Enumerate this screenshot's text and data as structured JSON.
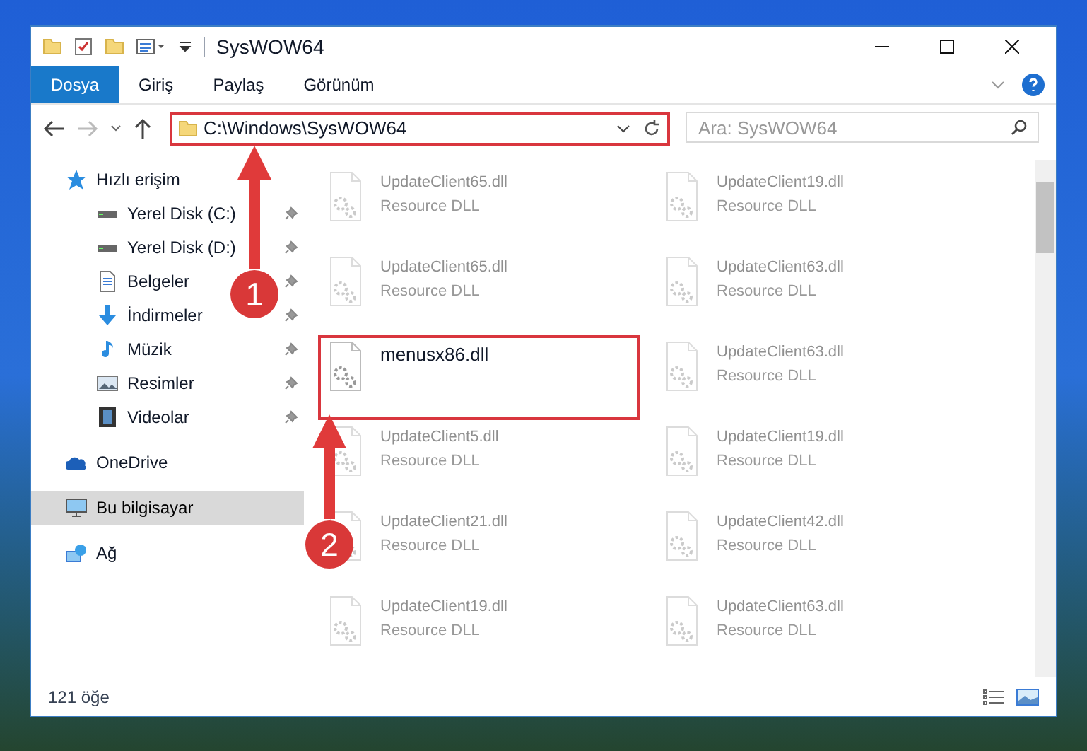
{
  "window": {
    "title": "SysWOW64"
  },
  "ribbon_tabs": [
    {
      "label": "Dosya",
      "selected": true
    },
    {
      "label": "Giriş",
      "selected": false
    },
    {
      "label": "Paylaş",
      "selected": false
    },
    {
      "label": "Görünüm",
      "selected": false
    }
  ],
  "address_bar": {
    "path": "C:\\Windows\\SysWOW64",
    "highlighted": true
  },
  "search": {
    "placeholder": "Ara: SysWOW64"
  },
  "sidebar": {
    "items": [
      {
        "label": "Hızlı erişim",
        "selected": false,
        "children": [
          {
            "label": "Yerel Disk (C:)",
            "pinned": true,
            "selected": false
          },
          {
            "label": "Yerel Disk (D:)",
            "pinned": true,
            "selected": false
          },
          {
            "label": "Belgeler",
            "pinned": true,
            "selected": false
          },
          {
            "label": "İndirmeler",
            "pinned": true,
            "selected": false
          },
          {
            "label": "Müzik",
            "pinned": true,
            "selected": false
          },
          {
            "label": "Resimler",
            "pinned": true,
            "selected": false
          },
          {
            "label": "Videolar",
            "pinned": true,
            "selected": false
          }
        ]
      },
      {
        "label": "OneDrive",
        "selected": false
      },
      {
        "label": "Bu bilgisayar",
        "selected": true
      },
      {
        "label": "Ağ",
        "selected": false
      }
    ]
  },
  "files": [
    {
      "name": "UpdateClient65.dll",
      "type": "Resource DLL",
      "highlighted": false
    },
    {
      "name": "UpdateClient19.dll",
      "type": "Resource DLL",
      "highlighted": false
    },
    {
      "name": "UpdateClient65.dll",
      "type": "Resource DLL",
      "highlighted": false
    },
    {
      "name": "UpdateClient63.dll",
      "type": "Resource DLL",
      "highlighted": false
    },
    {
      "name": "menusx86.dll",
      "highlighted": true
    },
    {
      "name": "UpdateClient63.dll",
      "type": "Resource DLL",
      "highlighted": false
    },
    {
      "name": "UpdateClient5.dll",
      "type": "Resource DLL",
      "highlighted": false
    },
    {
      "name": "UpdateClient19.dll",
      "type": "Resource DLL",
      "highlighted": false
    },
    {
      "name": "UpdateClient21.dll",
      "type": "Resource DLL",
      "highlighted": false
    },
    {
      "name": "UpdateClient42.dll",
      "type": "Resource DLL",
      "highlighted": false
    },
    {
      "name": "UpdateClient19.dll",
      "type": "Resource DLL",
      "highlighted": false
    },
    {
      "name": "UpdateClient63.dll",
      "type": "Resource DLL",
      "highlighted": false
    }
  ],
  "annotations": [
    {
      "number": "1"
    },
    {
      "number": "2"
    }
  ],
  "status_bar": {
    "item_count": "121 öğe"
  }
}
